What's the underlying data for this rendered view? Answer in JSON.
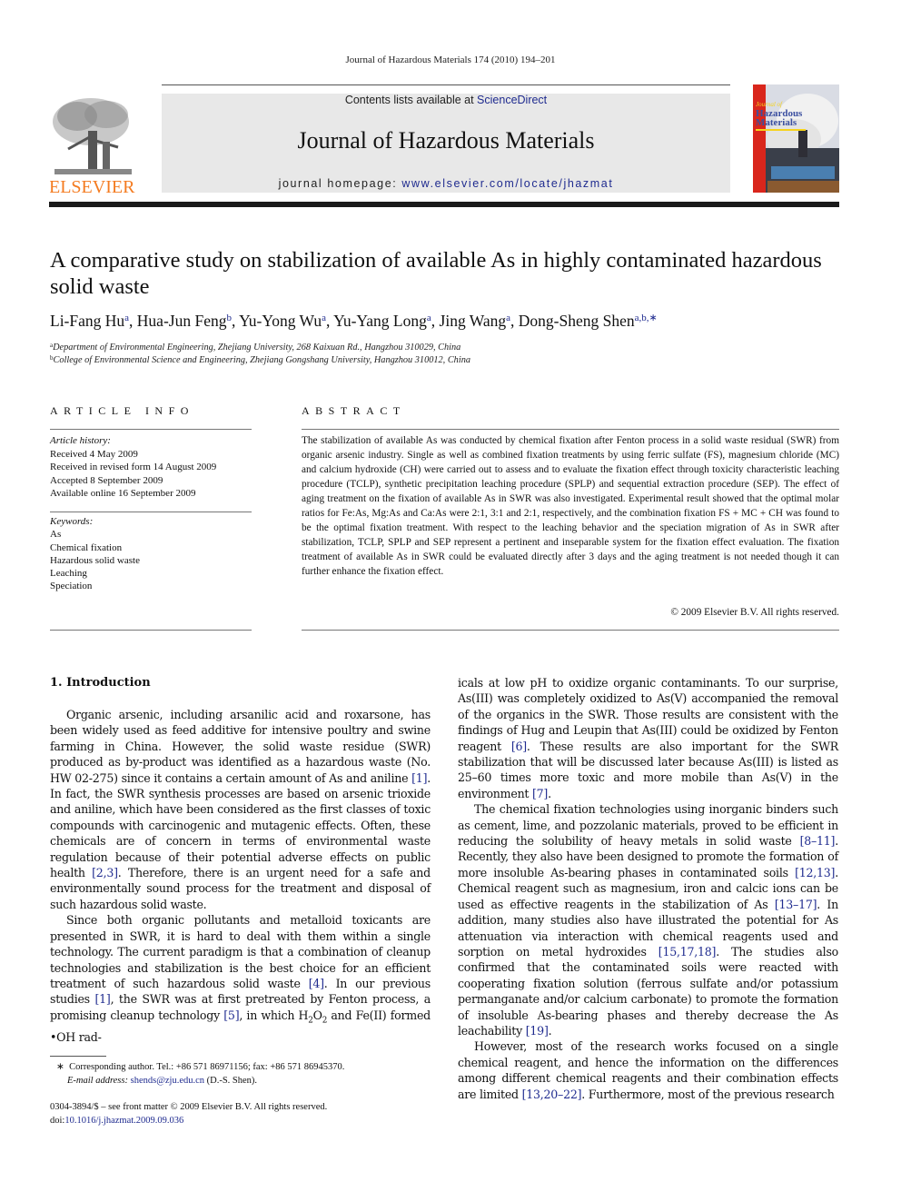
{
  "header": {
    "running_head": "Journal of Hazardous Materials 174 (2010) 194–201",
    "contents_prefix": "Contents lists available at ",
    "contents_link": "ScienceDirect",
    "journal_name": "Journal of Hazardous Materials",
    "homepage_prefix": "journal homepage: ",
    "homepage_link": "www.elsevier.com/locate/jhazmat",
    "publisher_logo_text": "ELSEVIER",
    "cover_title_line1": "Journal of",
    "cover_title_line2": "Hazardous",
    "cover_title_line3": "Materials",
    "colors": {
      "elsevier_orange": "#f47b20",
      "link_blue": "#1f2b8f",
      "banner_gray": "#e8e8e8",
      "cover_red": "#d9261c"
    }
  },
  "article": {
    "title": "A comparative study on stabilization of available As in highly contaminated hazardous solid waste",
    "authors": [
      {
        "name": "Li-Fang Hu",
        "sup": "a"
      },
      {
        "name": "Hua-Jun Feng",
        "sup": "b"
      },
      {
        "name": "Yu-Yong Wu",
        "sup": "a"
      },
      {
        "name": "Yu-Yang Long",
        "sup": "a"
      },
      {
        "name": "Jing Wang",
        "sup": "a"
      },
      {
        "name": "Dong-Sheng Shen",
        "sup": "a,b,∗"
      }
    ],
    "affiliations": [
      {
        "mark": "a",
        "text": "Department of Environmental Engineering, Zhejiang University, 268 Kaixuan Rd., Hangzhou 310029, China"
      },
      {
        "mark": "b",
        "text": "College of Environmental Science and Engineering, Zhejiang Gongshang University, Hangzhou 310012, China"
      }
    ]
  },
  "article_info": {
    "heading": "ARTICLE INFO",
    "history_label": "Article history:",
    "history": [
      "Received 4 May 2009",
      "Received in revised form 14 August 2009",
      "Accepted 8 September 2009",
      "Available online 16 September 2009"
    ],
    "keywords_label": "Keywords:",
    "keywords": [
      "As",
      "Chemical fixation",
      "Hazardous solid waste",
      "Leaching",
      "Speciation"
    ]
  },
  "abstract": {
    "heading": "ABSTRACT",
    "text": "The stabilization of available As was conducted by chemical fixation after Fenton process in a solid waste residual (SWR) from organic arsenic industry. Single as well as combined fixation treatments by using ferric sulfate (FS), magnesium chloride (MC) and calcium hydroxide (CH) were carried out to assess and to evaluate the fixation effect through toxicity characteristic leaching procedure (TCLP), synthetic precipitation leaching procedure (SPLP) and sequential extraction procedure (SEP). The effect of aging treatment on the fixation of available As in SWR was also investigated. Experimental result showed that the optimal molar ratios for Fe:As, Mg:As and Ca:As were 2:1, 3:1 and 2:1, respectively, and the combination fixation FS + MC + CH was found to be the optimal fixation treatment. With respect to the leaching behavior and the speciation migration of As in SWR after stabilization, TCLP, SPLP and SEP represent a pertinent and inseparable system for the fixation effect evaluation. The fixation treatment of available As in SWR could be evaluated directly after 3 days and the aging treatment is not needed though it can further enhance the fixation effect.",
    "copyright": "© 2009 Elsevier B.V. All rights reserved."
  },
  "body": {
    "intro_heading": "1.  Introduction",
    "left_paragraphs": [
      [
        {
          "t": "Organic arsenic, including arsanilic acid and roxarsone, has been widely used as feed additive for intensive poultry and swine farming in China. However, the solid waste residue (SWR) produced as by-product was identified as a hazardous waste (No. HW 02-275) since it contains a certain amount of As and aniline "
        },
        {
          "t": "[1]",
          "ref": true
        },
        {
          "t": ". In fact, the SWR synthesis processes are based on arsenic trioxide and aniline, which have been considered as the first classes of toxic compounds with carcinogenic and mutagenic effects. Often, these chemicals are of concern in terms of environmental waste regulation because of their potential adverse effects on public health "
        },
        {
          "t": "[2,3]",
          "ref": true
        },
        {
          "t": ". Therefore, there is an urgent need for a safe and environmentally sound process for the treatment and disposal of such hazardous solid waste."
        }
      ],
      [
        {
          "t": "Since both organic pollutants and metalloid toxicants are presented in SWR, it is hard to deal with them within a single technology. The current paradigm is that a combination of cleanup technologies and stabilization is the best choice for an efficient treatment of such hazardous solid waste "
        },
        {
          "t": "[4]",
          "ref": true
        },
        {
          "t": ". In our previous studies "
        },
        {
          "t": "[1]",
          "ref": true
        },
        {
          "t": ", the SWR was at first pretreated by Fenton process, a promising cleanup technology "
        },
        {
          "t": "[5]",
          "ref": true
        },
        {
          "t": ", in which H"
        },
        {
          "t": "2",
          "sub": true
        },
        {
          "t": "O"
        },
        {
          "t": "2",
          "sub": true
        },
        {
          "t": " and Fe(II) formed •OH rad-"
        }
      ]
    ],
    "right_paragraphs": [
      [
        {
          "t": "icals at low pH to oxidize organic contaminants. To our surprise, As(III) was completely oxidized to As(V) accompanied the removal of the organics in the SWR. Those results are consistent with the findings of Hug and Leupin that As(III) could be oxidized by Fenton reagent "
        },
        {
          "t": "[6]",
          "ref": true
        },
        {
          "t": ". These results are also important for the SWR stabilization that will be discussed later because As(III) is listed as 25–60 times more toxic and more mobile than As(V) in the environment "
        },
        {
          "t": "[7]",
          "ref": true
        },
        {
          "t": "."
        }
      ],
      [
        {
          "t": "The chemical fixation technologies using inorganic binders such as cement, lime, and pozzolanic materials, proved to be efficient in reducing the solubility of heavy metals in solid waste "
        },
        {
          "t": "[8–11]",
          "ref": true
        },
        {
          "t": ". Recently, they also have been designed to promote the formation of more insoluble As-bearing phases in contaminated soils "
        },
        {
          "t": "[12,13]",
          "ref": true
        },
        {
          "t": ". Chemical reagent such as magnesium, iron and calcic ions can be used as effective reagents in the stabilization of As "
        },
        {
          "t": "[13–17]",
          "ref": true
        },
        {
          "t": ". In addition, many studies also have illustrated the potential for As attenuation via interaction with chemical reagents used and sorption on metal hydroxides "
        },
        {
          "t": "[15,17,18]",
          "ref": true
        },
        {
          "t": ". The studies also confirmed that the contaminated soils were reacted with cooperating fixation solution (ferrous sulfate and/or potassium permanganate and/or calcium carbonate) to promote the formation of insoluble As-bearing phases and thereby decrease the As leachability "
        },
        {
          "t": "[19]",
          "ref": true
        },
        {
          "t": "."
        }
      ],
      [
        {
          "t": "However, most of the research works focused on a single chemical reagent, and hence the information on the differences among different chemical reagents and their combination effects are limited "
        },
        {
          "t": "[13,20–22]",
          "ref": true
        },
        {
          "t": ". Furthermore, most of the previous research"
        }
      ]
    ]
  },
  "footnote": {
    "mark": "∗",
    "corresponding": "Corresponding author. Tel.: +86 571 86971156; fax: +86 571 86945370.",
    "email_label": "E-mail address:",
    "email": "shends@zju.edu.cn",
    "email_suffix": " (D.-S. Shen).",
    "front_matter": "0304-3894/$ – see front matter © 2009 Elsevier B.V. All rights reserved.",
    "doi_label": "doi:",
    "doi": "10.1016/j.jhazmat.2009.09.036"
  }
}
